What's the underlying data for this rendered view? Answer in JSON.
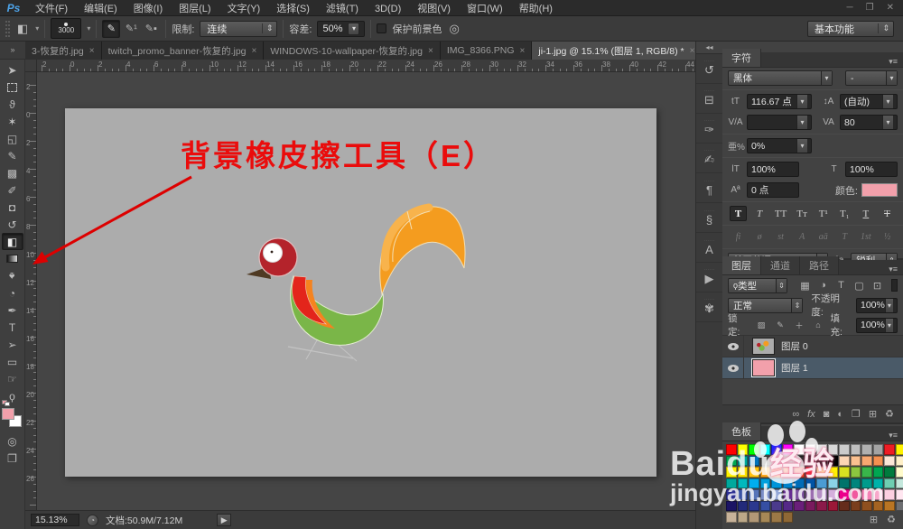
{
  "window": {
    "logo": "Ps",
    "controls": {
      "minimize": "─",
      "maximize": "❐",
      "close": "✕"
    }
  },
  "menu_items": [
    {
      "id": "file",
      "label": "文件(F)"
    },
    {
      "id": "edit",
      "label": "编辑(E)"
    },
    {
      "id": "image",
      "label": "图像(I)"
    },
    {
      "id": "layer",
      "label": "图层(L)"
    },
    {
      "id": "type",
      "label": "文字(Y)"
    },
    {
      "id": "select",
      "label": "选择(S)"
    },
    {
      "id": "filter",
      "label": "滤镜(T)"
    },
    {
      "id": "3d",
      "label": "3D(D)"
    },
    {
      "id": "view",
      "label": "视图(V)"
    },
    {
      "id": "window",
      "label": "窗口(W)"
    },
    {
      "id": "help",
      "label": "帮助(H)"
    }
  ],
  "options": {
    "tool_icon": "◧",
    "brush_size": "3000",
    "sampling": [
      {
        "name": "sampling-continuous-button",
        "glyph": "✎",
        "selected": true
      },
      {
        "name": "sampling-once-button",
        "glyph": "✎¹",
        "selected": false
      },
      {
        "name": "sampling-background-swatch-button",
        "glyph": "✎▪",
        "selected": false
      }
    ],
    "limit_label": "限制:",
    "limit_value": "连续",
    "tolerance_label": "容差:",
    "tolerance_value": "50%",
    "protect_label": "保护前景色",
    "airbrush_glyph": "◎",
    "workspace": "基本功能"
  },
  "tabs_overflow": "»",
  "toolbar_overflow": "»",
  "tabs": [
    {
      "title": "3-恢复的.jpg",
      "close": "×",
      "active": false
    },
    {
      "title": "twitch_promo_banner-恢复的.jpg",
      "close": "×",
      "active": false
    },
    {
      "title": "WINDOWS-10-wallpaper-恢复的.jpg",
      "close": "×",
      "active": false
    },
    {
      "title": "IMG_8366.PNG",
      "close": "×",
      "active": false
    },
    {
      "title": "ji-1.jpg @ 15.1% (图层 1, RGB/8) *",
      "close": "×",
      "active": true
    }
  ],
  "tools": [
    {
      "name": "move-tool",
      "glyph": "➤"
    },
    {
      "name": "rectangular-marquee-tool",
      "glyph": ""
    },
    {
      "name": "lasso-tool",
      "glyph": "ϑ"
    },
    {
      "name": "magic-wand-tool",
      "glyph": "✶"
    },
    {
      "name": "crop-tool",
      "glyph": "◱"
    },
    {
      "name": "eyedropper-tool",
      "glyph": "✎"
    },
    {
      "name": "healing-brush-tool",
      "glyph": "▩"
    },
    {
      "name": "brush-tool",
      "glyph": "✐"
    },
    {
      "name": "clone-stamp-tool",
      "glyph": "◘"
    },
    {
      "name": "history-brush-tool",
      "glyph": "↺"
    },
    {
      "name": "background-eraser-tool",
      "glyph": "◧",
      "selected": true
    },
    {
      "name": "gradient-tool",
      "glyph": ""
    },
    {
      "name": "blur-tool",
      "glyph": "♠",
      "cls": "rot180"
    },
    {
      "name": "dodge-tool",
      "glyph": "◔"
    },
    {
      "name": "pen-tool",
      "glyph": "✒"
    },
    {
      "name": "type-tool",
      "glyph": "T"
    },
    {
      "name": "path-selection-tool",
      "glyph": "➢"
    },
    {
      "name": "rectangle-tool",
      "glyph": "▭"
    },
    {
      "name": "hand-tool",
      "glyph": "☞"
    },
    {
      "name": "zoom-tool",
      "glyph": "ϙ"
    }
  ],
  "extra_tools": [
    {
      "name": "quick-mask-button",
      "glyph": "◎"
    },
    {
      "name": "screen-mode-button",
      "glyph": "❐"
    }
  ],
  "tool_colors": {
    "foreground": "#F2A0AB",
    "background": "#FFFFFF"
  },
  "ruler": {
    "top_numbers": [
      "2",
      "0",
      "2",
      "4",
      "6",
      "8",
      "10",
      "12",
      "14",
      "16",
      "18",
      "20",
      "22",
      "24",
      "26",
      "28",
      "30",
      "32",
      "34",
      "36",
      "38",
      "40",
      "42",
      "44"
    ],
    "left_numbers": [
      "2",
      "0",
      "2",
      "4",
      "6",
      "8",
      "10",
      "12",
      "14",
      "16",
      "18",
      "20",
      "22",
      "24",
      "26"
    ]
  },
  "canvas": {
    "annotation": "背景橡皮擦工具（E）",
    "annotation_color": "#EA0C0C",
    "arrow_color": "#DD0000"
  },
  "dock_icons": [
    {
      "name": "history-panel-icon",
      "glyph": "↺"
    },
    {
      "name": "properties-panel-icon",
      "glyph": "⊟"
    },
    {
      "name": "brush-panel-icon",
      "glyph": "✑"
    },
    {
      "name": "brush-presets-panel-icon",
      "glyph": "✍"
    },
    {
      "name": "paragraph-panel-icon",
      "glyph": "¶"
    },
    {
      "name": "paragraph-styles-panel-icon",
      "glyph": "§"
    },
    {
      "name": "character-styles-panel-icon",
      "glyph": "A"
    },
    {
      "name": "actions-panel-icon",
      "glyph": "▶"
    },
    {
      "name": "tool-presets-panel-icon",
      "glyph": "✾"
    }
  ],
  "dock_collapse": "◂◂",
  "character_panel": {
    "tab": "字符",
    "font_family": "黑体",
    "font_style": "-",
    "size_icon": "tT",
    "size_value": "116.67 点",
    "leading_icon": "↕A",
    "leading_value": "(自动)",
    "kerning_icon": "V/A",
    "kerning_value": "",
    "tracking_icon": "VA",
    "tracking_value": "80",
    "tsume_icon": "亜%",
    "tsume_value": "0%",
    "vscale_icon": "ǀT",
    "vscale_value": "100%",
    "hscale_icon": "T",
    "hscale_value": "100%",
    "baseline_icon": "Aª",
    "baseline_value": "0 点",
    "color_label": "颜色:",
    "color_value": "#F2A0AB",
    "style_buttons": [
      "T",
      "T",
      "TT",
      "Tᴛ",
      "T¹",
      "T₁",
      "T",
      "T"
    ],
    "opentype_buttons": [
      "fi",
      "ø",
      "st",
      "A",
      "aā",
      "T",
      "1st",
      "½"
    ],
    "language": "美国英语",
    "antialias_icon": "ªa",
    "antialias": "锐利"
  },
  "layers_panel": {
    "tabs": [
      "图层",
      "通道",
      "路径"
    ],
    "filter_search_icon": "ϙ",
    "filter_label": "类型",
    "filter_icons": [
      {
        "name": "filter-pixel-layers-icon",
        "glyph": "▦"
      },
      {
        "name": "filter-adjustment-layers-icon",
        "glyph": "◑"
      },
      {
        "name": "filter-type-layers-icon",
        "glyph": "T"
      },
      {
        "name": "filter-shape-layers-icon",
        "glyph": "▢"
      },
      {
        "name": "filter-smart-objects-icon",
        "glyph": "⊡"
      }
    ],
    "blend_mode": "正常",
    "opacity_label": "不透明度:",
    "opacity": "100%",
    "lock_label": "锁定:",
    "lock_icons": [
      {
        "name": "lock-transparency-icon",
        "glyph": "▨"
      },
      {
        "name": "lock-pixels-icon",
        "glyph": "✎"
      },
      {
        "name": "lock-position-icon",
        "glyph": "＋"
      },
      {
        "name": "lock-all-icon",
        "glyph": "⌂"
      }
    ],
    "fill_label": "填充:",
    "fill": "100%",
    "layers": [
      {
        "name": "图层 0",
        "thumb": "bird",
        "selected": false
      },
      {
        "name": "图层 1",
        "thumb": "#F2A0AB",
        "selected": true
      }
    ],
    "bottom_icons": [
      {
        "name": "link-layers-icon",
        "glyph": "∞"
      },
      {
        "name": "layer-effects-icon",
        "glyph": "fx"
      },
      {
        "name": "add-layer-mask-icon",
        "glyph": "◙"
      },
      {
        "name": "adjustment-layer-icon",
        "glyph": "◐"
      },
      {
        "name": "layer-group-icon",
        "glyph": "❐"
      },
      {
        "name": "new-layer-icon",
        "glyph": "⊞"
      },
      {
        "name": "delete-layer-icon",
        "glyph": "♻"
      }
    ]
  },
  "swatches_panel": {
    "tab": "色板",
    "colors": [
      "#FF0000",
      "#FFFF00",
      "#00FF00",
      "#00FFFF",
      "#2323FF",
      "#FF00FF",
      "#FFFFFF",
      "#F2F2F2",
      "#E5E5E5",
      "#D8D8D8",
      "#CBCBCB",
      "#BEBEBE",
      "#B0B0B0",
      "#A3A3A3",
      "#ED1C24",
      "#FFF200",
      "#00A651",
      "#00A99D",
      "#0072BC",
      "#4D4D4D",
      "#424242",
      "#383838",
      "#2D2D2D",
      "#212121",
      "#111111",
      "#000000",
      "#FCD5B5",
      "#FAC090",
      "#F7A871",
      "#F49051",
      "#FBE5D6",
      "#FFF0C8",
      "#FFF200",
      "#FFE100",
      "#FFC20E",
      "#FAA61A",
      "#F7941D",
      "#F26522",
      "#EF4123",
      "#ED1C24",
      "#FFF9AE",
      "#FFF200",
      "#D9E021",
      "#8DC63F",
      "#39B54A",
      "#00A651",
      "#007A3D",
      "#FFFBCC",
      "#00A99D",
      "#00B9BD",
      "#00AEEF",
      "#00A0DD",
      "#0095DA",
      "#0082CA",
      "#006CB7",
      "#0054A6",
      "#4B9CD3",
      "#8BD2E6",
      "#00746B",
      "#00857D",
      "#009B8C",
      "#00B2A9",
      "#6ECEB2",
      "#C5E8DD",
      "#2E3192",
      "#3A53A4",
      "#5674B9",
      "#7B8DC8",
      "#93A8D8",
      "#662D91",
      "#7E52A0",
      "#9B6FB0",
      "#B58FC5",
      "#D4AFDC",
      "#EC008C",
      "#F0599E",
      "#F481B4",
      "#F8A8CB",
      "#FCCFE0",
      "#FFE6F0",
      "#1B1464",
      "#222A7A",
      "#2B388F",
      "#364FA3",
      "#4B3A8C",
      "#552988",
      "#6A1F7A",
      "#7A1B5E",
      "#8B1A4A",
      "#9C1838",
      "#652C1B",
      "#7A3E1D",
      "#8F501F",
      "#A46321",
      "#B97523",
      "#6D6E71",
      "#C7B299",
      "#BCA888",
      "#B19877",
      "#A68856",
      "#9B7846",
      "#8F6835"
    ],
    "bottom_icons": [
      {
        "name": "new-swatch-icon",
        "glyph": "⊞"
      },
      {
        "name": "delete-swatch-icon",
        "glyph": "♻"
      }
    ]
  },
  "status": {
    "zoom": "15.13%",
    "drive_glyph": "◔",
    "doc_info": "文档:50.9M/7.12M",
    "flyout": "▶"
  },
  "watermark": {
    "brand": "Baidu",
    "brand_suffix": "经验",
    "url": "jingyan.baidu.com"
  }
}
